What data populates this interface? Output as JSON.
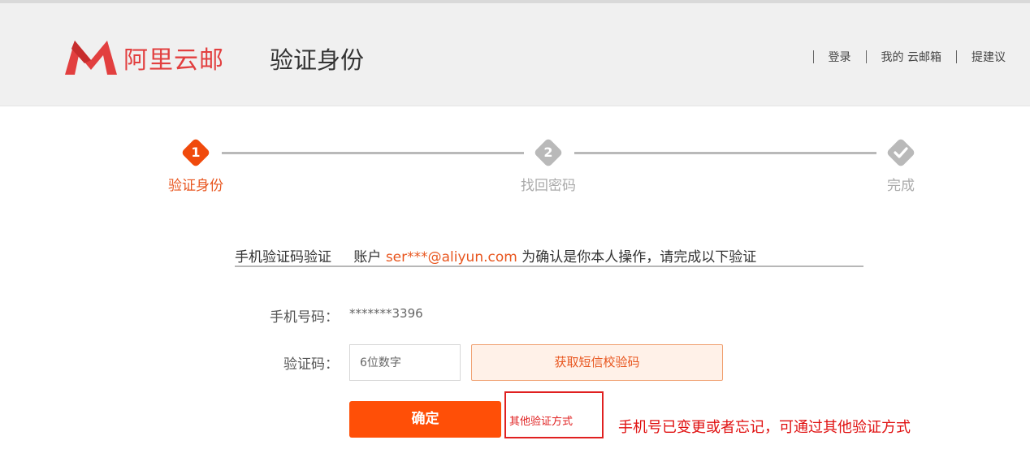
{
  "header": {
    "brand": "阿里云邮",
    "title": "验证身份",
    "nav": [
      "登录",
      "我的 云邮箱",
      "提建议"
    ],
    "brand_color": "#e23f3f"
  },
  "steps": [
    {
      "number": "1",
      "label": "验证身份",
      "state": "active"
    },
    {
      "number": "2",
      "label": "找回密码",
      "state": "pending"
    },
    {
      "number": "",
      "label": "完成",
      "state": "pending",
      "icon": "check-icon"
    }
  ],
  "verify": {
    "method": "手机验证码验证",
    "account_prefix": "账户",
    "email": "ser***@aliyun.com",
    "account_suffix": "为确认是你本人操作，请完成以下验证"
  },
  "form": {
    "phone_label": "手机号码：",
    "phone_value": "*******3396",
    "code_label": "验证码：",
    "code_placeholder": "6位数字",
    "sms_button": "获取短信校验码",
    "confirm_button": "确定",
    "other_method": "其他验证方式"
  },
  "annotation": "手机号已变更或者忘记，可通过其他验证方式",
  "colors": {
    "accent": "#ff4f07",
    "active_step": "#f04a0c",
    "inactive_step": "#b9b9b9",
    "annotation": "#e01010"
  }
}
